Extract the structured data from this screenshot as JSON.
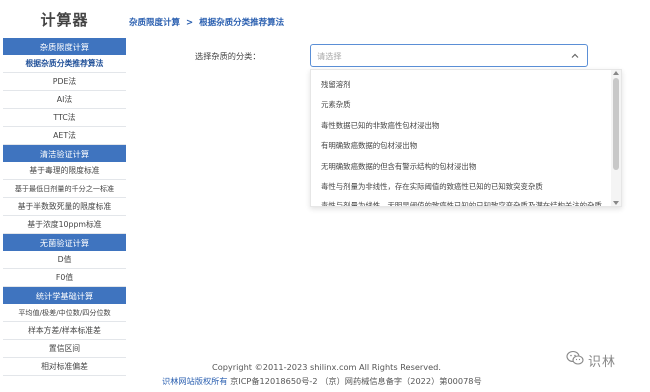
{
  "app_title": "计算器",
  "breadcrumb": {
    "parent": "杂质限度计算",
    "separator": ">",
    "current": "根据杂质分类推荐算法"
  },
  "sidebar": {
    "sections": [
      {
        "header": "杂质限度计算",
        "items": [
          "根据杂质分类推荐算法",
          "PDE法",
          "AI法",
          "TTC法",
          "AET法"
        ]
      },
      {
        "header": "清洁验证计算",
        "items": [
          "基于毒理的限度标准",
          "基于最低日剂量的千分之一标准",
          "基于半数致死量的限度标准",
          "基于浓度10ppm标准"
        ]
      },
      {
        "header": "无菌验证计算",
        "items": [
          "D值",
          "F0值"
        ]
      },
      {
        "header": "统计学基础计算",
        "items": [
          "平均值/极差/中位数/四分位数",
          "样本方差/样本标准差",
          "置信区间",
          "相对标准偏差"
        ]
      }
    ]
  },
  "form": {
    "label": "选择杂质的分类：",
    "placeholder": "请选择",
    "options": [
      "残留溶剂",
      "元素杂质",
      "毒性数据已知的非致癌性包材浸出物",
      "有明确致癌数据的包材浸出物",
      "无明确致癌数据的但含有警示结构的包材浸出物",
      "毒性与剂量为非线性，存在实际阈值的致癌性已知的已知致突变杂质",
      "毒性与剂量为线性，无明显阈值的致癌性已知的已知致突变杂质及潜在结构关注的杂质"
    ]
  },
  "footer": {
    "copyright": "Copyright ©2011-2023 shilinx.com All Rights Reserved.",
    "site_link": "识林网站版权所有",
    "icp": " 京ICP备12018650号-2 （京）网药械信息备字（2022）第00078号"
  },
  "watermark": {
    "text": "识林"
  },
  "colors": {
    "section_header": "#3f74bf",
    "accent": "#2a5fb0",
    "select_border": "#5b8fd6"
  }
}
